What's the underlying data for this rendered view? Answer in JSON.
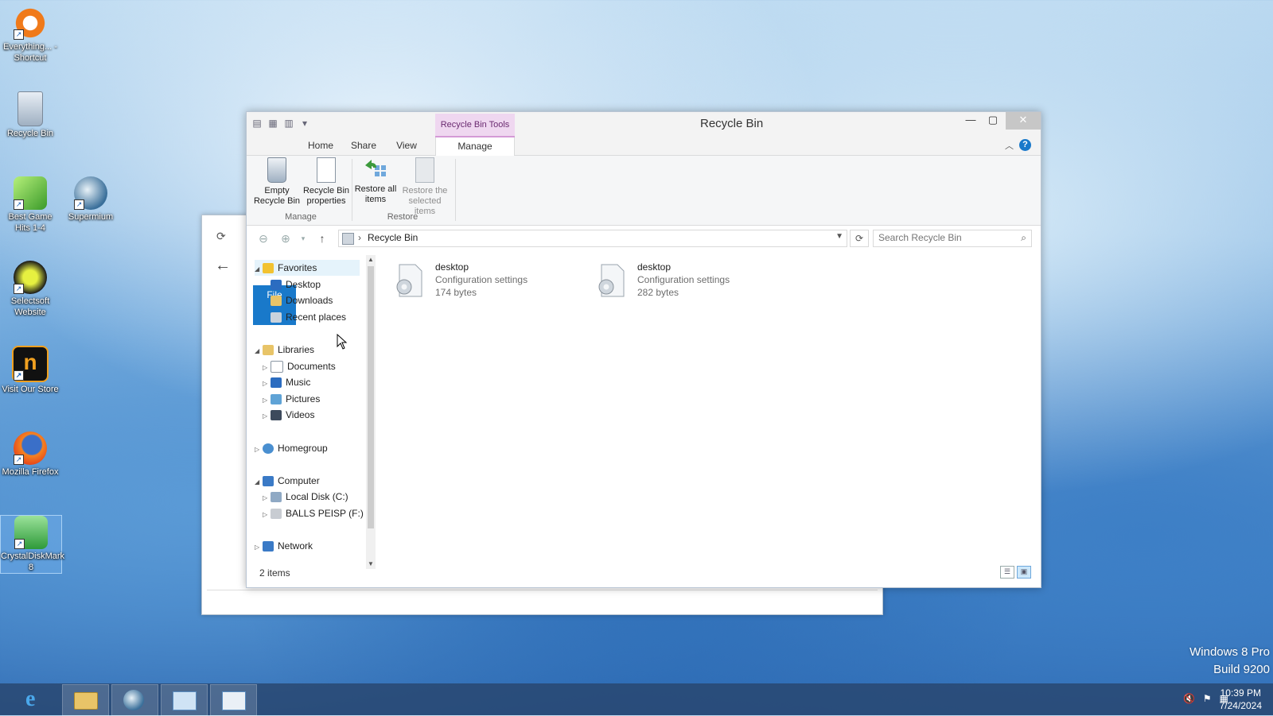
{
  "desktop": {
    "icons": [
      {
        "label": "Everything... - Shortcut"
      },
      {
        "label": "Recycle Bin"
      },
      {
        "label": "Best Game Hits 1-4"
      },
      {
        "label": "Supermium"
      },
      {
        "label": "Selectsoft Website"
      },
      {
        "label": "Visit Our Store"
      },
      {
        "label": "Mozilla Firefox"
      },
      {
        "label": "CrystalDiskMark 8"
      }
    ]
  },
  "window": {
    "title": "Recycle Bin",
    "context_tab": "Recycle Bin Tools",
    "tabs": [
      {
        "label": "File"
      },
      {
        "label": "Home"
      },
      {
        "label": "Share"
      },
      {
        "label": "View"
      },
      {
        "label": "Manage"
      }
    ],
    "ribbon": {
      "buttons": [
        {
          "label": "Empty Recycle Bin"
        },
        {
          "label": "Recycle Bin properties"
        },
        {
          "label": "Restore all items"
        },
        {
          "label": "Restore the selected items"
        }
      ],
      "groups": [
        {
          "label": "Manage"
        },
        {
          "label": "Restore"
        }
      ]
    },
    "address": {
      "crumb": "Recycle Bin"
    },
    "search": {
      "placeholder": "Search Recycle Bin"
    },
    "nav": {
      "items": [
        {
          "label": "Favorites"
        },
        {
          "label": "Desktop"
        },
        {
          "label": "Downloads"
        },
        {
          "label": "Recent places"
        },
        {
          "label": "Libraries"
        },
        {
          "label": "Documents"
        },
        {
          "label": "Music"
        },
        {
          "label": "Pictures"
        },
        {
          "label": "Videos"
        },
        {
          "label": "Homegroup"
        },
        {
          "label": "Computer"
        },
        {
          "label": "Local Disk (C:)"
        },
        {
          "label": "BALLS PEISP (F:)"
        },
        {
          "label": "Network"
        }
      ]
    },
    "files": [
      {
        "name": "desktop",
        "type": "Configuration settings",
        "size": "174 bytes"
      },
      {
        "name": "desktop",
        "type": "Configuration settings",
        "size": "282 bytes"
      }
    ],
    "status": "2 items"
  },
  "taskbar": {
    "time": "10:39 PM",
    "date": "7/24/2024"
  },
  "watermark": {
    "line1": "Windows 8 Pro",
    "line2": "Build 9200"
  }
}
